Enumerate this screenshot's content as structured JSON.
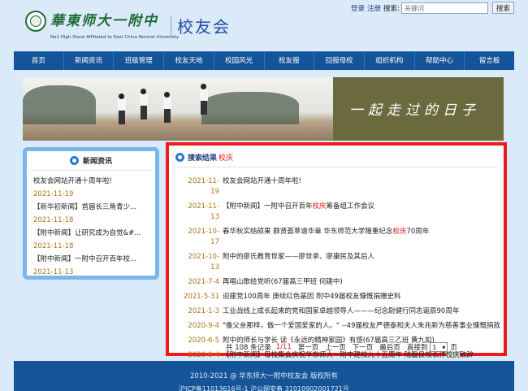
{
  "header": {
    "logo_cn": "華東师大一附中",
    "logo_en": "No1  High Shool Affiliated to East China Normal University",
    "tagline": "校友会",
    "links": {
      "login": "登录",
      "register": "注册",
      "search_label": "搜索:"
    },
    "search_placeholder": "关键词",
    "search_button": "搜索"
  },
  "nav": [
    "首页",
    "新闻资讯",
    "班级管理",
    "校友天地",
    "校园风光",
    "校友报",
    "回报母校",
    "组织机构",
    "帮助中心",
    "留言板"
  ],
  "banner": {
    "slogan": "一起走过的日子"
  },
  "sidebar": {
    "title": "新闻资讯",
    "items": [
      {
        "title": "校友会网站开通十周年啦!",
        "date": "2021-11-19"
      },
      {
        "title": "【新华初新闻】首届长三角青少...",
        "date": "2021-11-18"
      },
      {
        "title": "【附中新闻】让研究成为自觉&#...",
        "date": "2021-11-18"
      },
      {
        "title": "【附中新闻】一附中召开百年校...",
        "date": "2021-11-13"
      }
    ]
  },
  "results": {
    "title": "搜索结果",
    "keyword": "校庆",
    "items": [
      {
        "date": "2021-11-19",
        "pre": "校友会网站开通十周年啦!",
        "hl": "",
        "post": ""
      },
      {
        "date": "2021-11-13",
        "pre": "【附中新闻】一附中召开百年",
        "hl": "校庆",
        "post": "筹备组工作会议"
      },
      {
        "date": "2021-10-17",
        "pre": "春华秋实结硕果 群贤荟萃谱华章 华东师范大学隆重纪念",
        "hl": "校庆",
        "post": "70周年"
      },
      {
        "date": "2021-10-13",
        "pre": "附中的廖氏教育世家——廖世承、廖康民及其后人",
        "hl": "",
        "post": ""
      },
      {
        "date": "2021-7-4",
        "pre": "再唱山歌给党听(67届高三甲班  何建中)",
        "hl": "",
        "post": ""
      },
      {
        "date": "2021-5-31",
        "pre": "迎建党100周年  庚续红色基因   附中49届校友慷慨捐赠史料",
        "hl": "",
        "post": ""
      },
      {
        "date": "2021-1-3",
        "pre": "工业战线上成长起来的党和国家卓越领导人———纪念尉健行同志诞辰90周年",
        "hl": "",
        "post": ""
      },
      {
        "date": "2020-9-4",
        "pre": "\"像父亲那样，做一个爱国爱家的人。\" --49届校友严德泰和夫人朱兆新为慈善事业慷慨捐款",
        "hl": "",
        "post": ""
      },
      {
        "date": "2020-6-5",
        "pre": "附中的师长与学长  读《永远的精神家园》有感(67届高三乙班  黄九如)",
        "hl": "",
        "post": ""
      },
      {
        "date": "2020-6-4",
        "pre": "【附中新闻】母校集会庆祝华东师大一附中建校九十五周年  陆磐良校长作",
        "hl": "校庆",
        "post": "致辞"
      }
    ],
    "pager": {
      "total_text": "共 108 条记录",
      "page_current": "1",
      "page_total": "/11",
      "first": "第一页",
      "prev": "上一页",
      "next": "下一页",
      "last": "最后页",
      "goto": "直接到",
      "selected": "1",
      "page_unit": "页"
    }
  },
  "footer": {
    "copyright": "2010-2021 @ 华东师大一附中校友会 版权所有",
    "icp": "沪ICP备11013616号-1      沪公网安备 31010902001721号"
  }
}
